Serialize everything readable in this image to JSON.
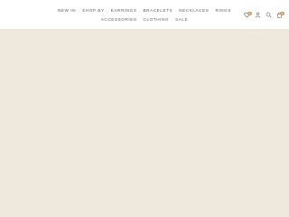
{
  "header": {
    "nav_row1": [
      {
        "label": "NEW IN"
      },
      {
        "label": "SHOP BY"
      },
      {
        "label": "EARRINGS"
      },
      {
        "label": "BRACELETS"
      },
      {
        "label": "NECKLACES"
      },
      {
        "label": "RINGS"
      }
    ],
    "nav_row2": [
      {
        "label": "ACCESSORIES"
      },
      {
        "label": "CLOTHING"
      },
      {
        "label": "SALE"
      }
    ],
    "wishlist_count": "0",
    "cart_count": "0"
  },
  "icons": {
    "wishlist": "heart-icon",
    "account": "user-icon",
    "search": "search-icon",
    "cart": "bag-icon"
  },
  "colors": {
    "badge": "#d29a5d",
    "hero_bg": "#eee8dd",
    "nav_text": "#5b5b5b"
  }
}
